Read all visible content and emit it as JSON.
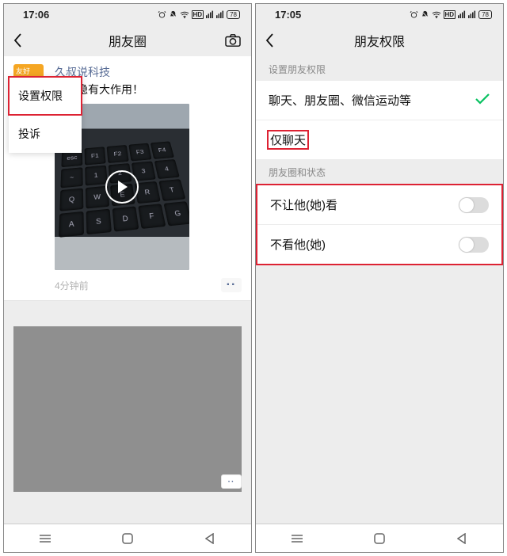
{
  "left": {
    "status_time": "17:06",
    "battery": "78",
    "title": "朋友圈",
    "popup": {
      "set_permission": "设置权限",
      "report": "投诉"
    },
    "feed": {
      "author": "久叔说科技",
      "text_suffix": "个键隐有大作用！",
      "timestamp": "4分钟前",
      "more": "··"
    },
    "floating_more": "··"
  },
  "right": {
    "status_time": "17:05",
    "battery": "78",
    "title": "朋友权限",
    "section1_label": "设置朋友权限",
    "option_full": "聊天、朋友圈、微信运动等",
    "option_chat_only": "仅聊天",
    "section2_label": "朋友圈和状态",
    "toggle_hide_mine": "不让他(她)看",
    "toggle_hide_theirs": "不看他(她)"
  }
}
